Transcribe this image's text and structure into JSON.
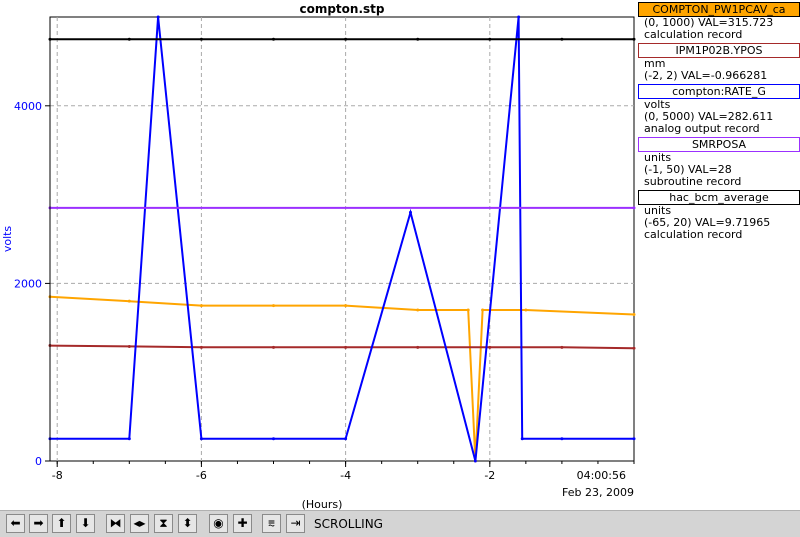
{
  "chart_data": {
    "type": "line",
    "title": "compton.stp",
    "xlabel": "(Hours)",
    "ylabel": "volts",
    "xlim": [
      -8.1,
      0.0
    ],
    "ylim": [
      0,
      5000
    ],
    "x_ticks": [
      "-8",
      "-6",
      "-4",
      "-2"
    ],
    "y_ticks": [
      "0",
      "2000",
      "4000"
    ],
    "y_tick_values": [
      0,
      2000,
      4000
    ],
    "x_tick_values": [
      -8,
      -6,
      -4,
      -2
    ],
    "end_time": "04:00:56",
    "end_date": "Feb 23, 2009",
    "grid": true,
    "series": [
      {
        "name": "COMPTON_PW1PCAV_ca",
        "color": "#ffa500",
        "x": [
          -8.1,
          -7,
          -6,
          -5,
          -4,
          -3,
          -2.3,
          -2.2,
          -2.1,
          -1.5,
          0
        ],
        "y": [
          1850,
          1800,
          1750,
          1750,
          1750,
          1700,
          1700,
          0,
          1700,
          1700,
          1650
        ]
      },
      {
        "name": "IPM1P02B.YPOS",
        "color": "#a52a2a",
        "x": [
          -8.1,
          -7,
          -6,
          -5,
          -4,
          -3,
          -2,
          -1,
          0
        ],
        "y": [
          1300,
          1290,
          1280,
          1280,
          1280,
          1280,
          1280,
          1280,
          1270
        ]
      },
      {
        "name": "compton:RATE_G",
        "color": "#0000ff",
        "x": [
          -8.1,
          -7,
          -6.6,
          -6,
          -5,
          -4,
          -3.1,
          -2.2,
          -1.6,
          -1.55,
          -1,
          0
        ],
        "y": [
          250,
          250,
          5000,
          250,
          250,
          250,
          2800,
          0,
          5000,
          250,
          250,
          250
        ]
      },
      {
        "name": "SMRPOSA",
        "color": "#9b30ff",
        "x": [
          -8.1,
          0
        ],
        "y": [
          2850,
          2850
        ]
      },
      {
        "name": "hac_bcm_average",
        "color": "#000000",
        "x": [
          -8.1,
          -7,
          -6,
          -5,
          -4,
          -3,
          -2,
          -1,
          0
        ],
        "y": [
          4750,
          4750,
          4750,
          4750,
          4750,
          4750,
          4750,
          4750,
          4750
        ]
      }
    ]
  },
  "legend": [
    {
      "title": "COMPTON_PW1PCAV_ca",
      "bg": "#ffa500",
      "border": "#000000",
      "lines": [
        "(0, 1000) VAL=315.723",
        "calculation record"
      ]
    },
    {
      "title": "IPM1P02B.YPOS",
      "bg": "#ffffff",
      "border": "#a52a2a",
      "lines": [
        "mm",
        "(-2, 2) VAL=-0.966281"
      ]
    },
    {
      "title": "compton:RATE_G",
      "bg": "#ffffff",
      "border": "#0000ff",
      "lines": [
        "volts",
        "(0, 5000) VAL=282.611",
        "analog output record"
      ]
    },
    {
      "title": "SMRPOSA",
      "bg": "#ffffff",
      "border": "#9b30ff",
      "lines": [
        "units",
        "(-1, 50) VAL=28",
        "subroutine record"
      ]
    },
    {
      "title": "hac_bcm_average",
      "bg": "#ffffff",
      "border": "#000000",
      "lines": [
        "units",
        "(-65, 20) VAL=9.71965",
        "calculation record"
      ]
    }
  ],
  "toolbar": {
    "status": "SCROLLING",
    "buttons": [
      {
        "icon": "arrow-left-icon",
        "glyph": "⬅"
      },
      {
        "icon": "arrow-right-icon",
        "glyph": "➡"
      },
      {
        "icon": "arrow-up-icon",
        "glyph": "⬆"
      },
      {
        "icon": "arrow-down-icon",
        "glyph": "⬇"
      },
      {
        "icon": "zoom-in-horizontal-icon",
        "glyph": "⧓"
      },
      {
        "icon": "zoom-out-horizontal-icon",
        "glyph": "◂▸"
      },
      {
        "icon": "zoom-in-vertical-icon",
        "glyph": "⧗"
      },
      {
        "icon": "zoom-out-vertical-icon",
        "glyph": "⬍"
      },
      {
        "icon": "stop-icon",
        "glyph": "◉"
      },
      {
        "icon": "plus-icon",
        "glyph": "✚"
      },
      {
        "icon": "autoscale-icon",
        "glyph": "⩳"
      },
      {
        "icon": "scroll-icon",
        "glyph": "⇥"
      }
    ]
  }
}
